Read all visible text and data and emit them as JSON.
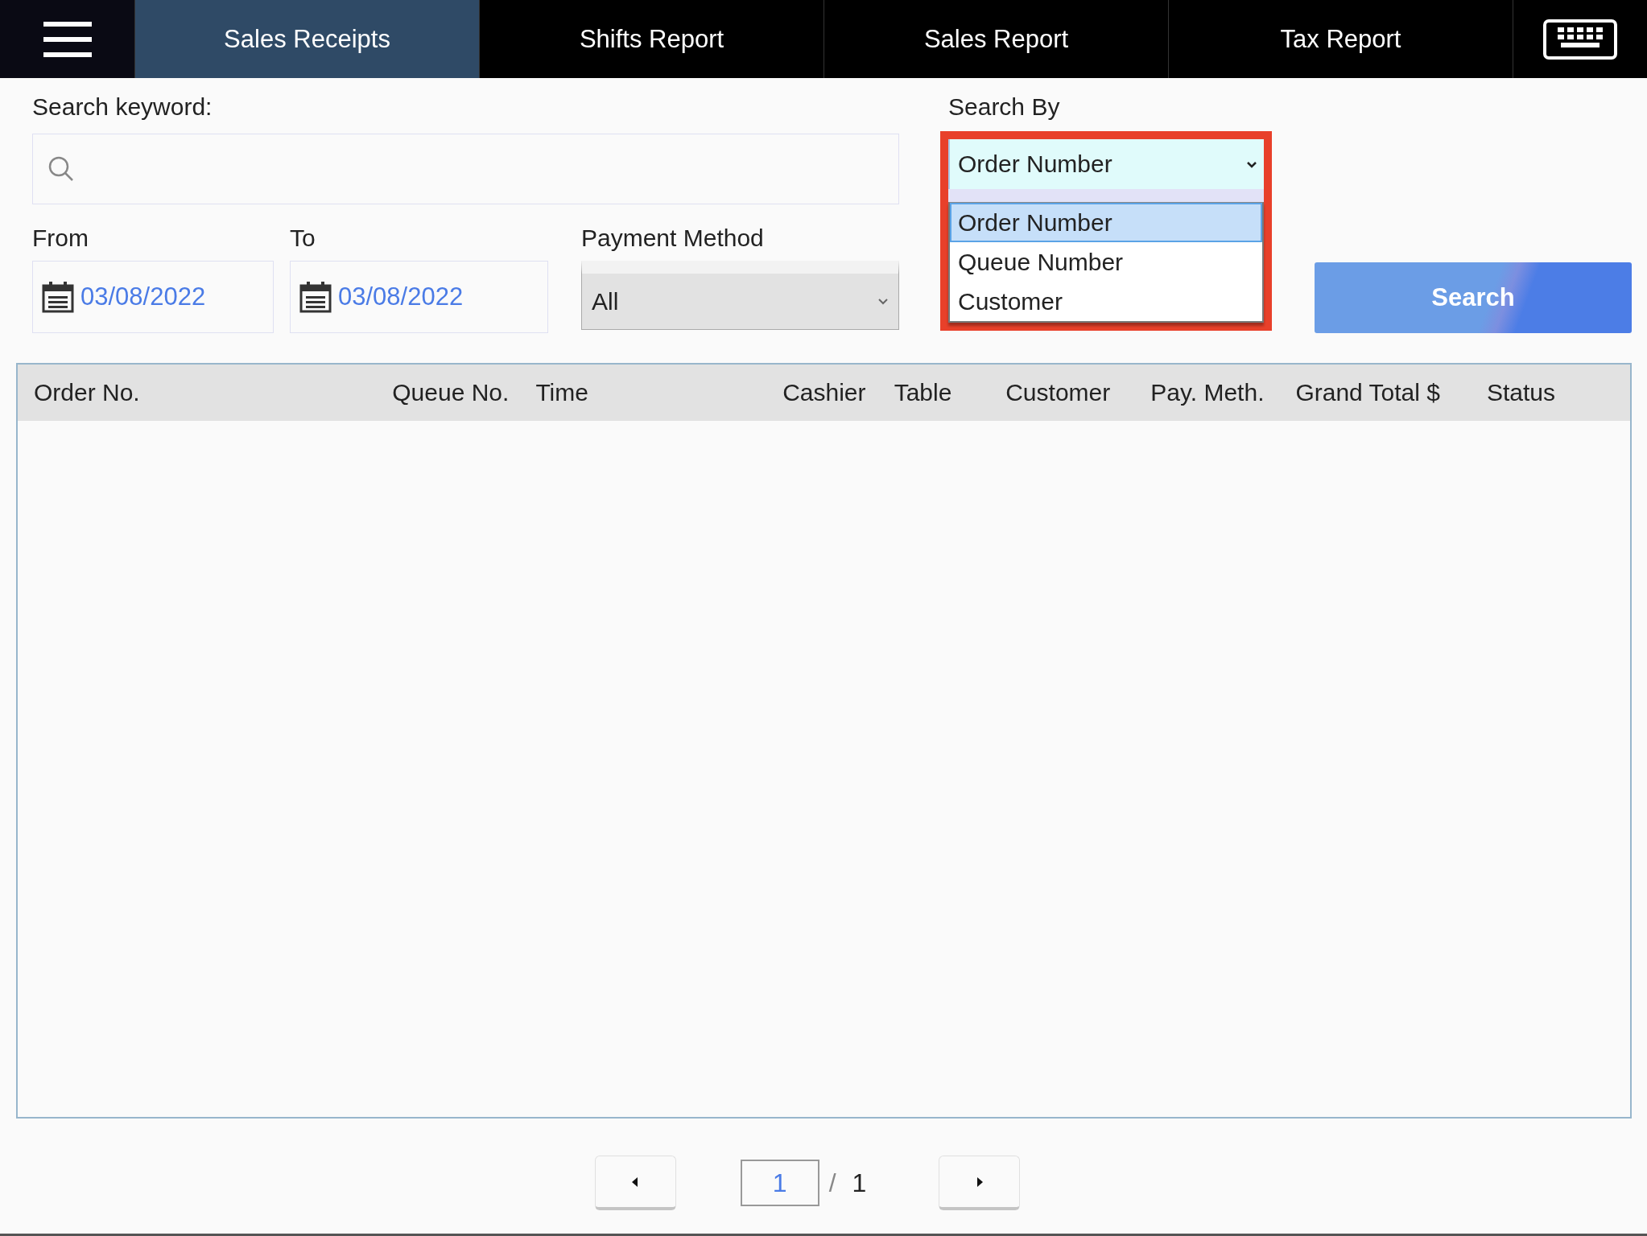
{
  "nav": {
    "tabs": [
      {
        "label": "Sales Receipts",
        "selected": true
      },
      {
        "label": "Shifts Report",
        "selected": false
      },
      {
        "label": "Sales Report",
        "selected": false
      },
      {
        "label": "Tax Report",
        "selected": false
      }
    ]
  },
  "search_keyword": {
    "label": "Search keyword:"
  },
  "search_by": {
    "label": "Search By",
    "value": "Order Number",
    "expanded": true,
    "highlighted": true,
    "options": [
      {
        "label": "Order Number",
        "selected": true
      },
      {
        "label": "Queue Number",
        "selected": false
      },
      {
        "label": "Customer",
        "selected": false
      }
    ]
  },
  "from": {
    "label": "From",
    "value": "03/08/2022"
  },
  "to": {
    "label": "To",
    "value": "03/08/2022"
  },
  "payment_method": {
    "label": "Payment Method",
    "value": "All"
  },
  "search_button": "Search",
  "table": {
    "columns": [
      "Order No.",
      "Queue No.",
      "Time",
      "Cashier",
      "Table",
      "Customer",
      "Pay. Meth.",
      "Grand Total $",
      "Status"
    ]
  },
  "pagination": {
    "page": "1",
    "separator": "/",
    "total": "1"
  }
}
